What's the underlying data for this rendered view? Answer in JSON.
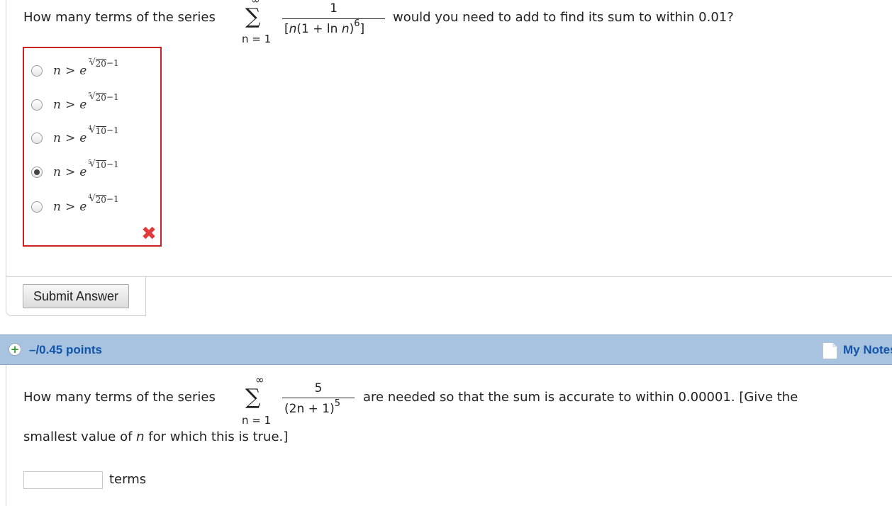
{
  "question1": {
    "prefix": "How many terms of the series",
    "sigma": "∑",
    "upper": "∞",
    "lower": "n = 1",
    "numerator": "1",
    "denominator_parts": [
      "[",
      "n",
      "(1 + ln ",
      "n",
      ")",
      "6",
      "]"
    ],
    "suffix": "would you need to add to find its sum to within 0.01?",
    "options": [
      {
        "index": "7",
        "radicand": "20",
        "tail": "−1",
        "selected": false
      },
      {
        "index": "5",
        "radicand": "20",
        "tail": "−1",
        "selected": false
      },
      {
        "index": "4",
        "radicand": "10",
        "tail": "−1",
        "selected": false
      },
      {
        "index": "5",
        "radicand": "10",
        "tail": "−1",
        "selected": true
      },
      {
        "index": "4",
        "radicand": "20",
        "tail": "−1",
        "selected": false
      }
    ],
    "option_lhs": "n",
    "option_rel": ">",
    "option_base": "e",
    "result_icon": "x-mark-icon",
    "submit_label": "Submit Answer"
  },
  "points_header": {
    "icon": "plus-circle-icon",
    "points": "–/0.45 points",
    "notes_icon": "notes-page-icon",
    "notes_label": "My Notes"
  },
  "question2": {
    "prefix": "How many terms of the series",
    "sigma": "∑",
    "upper": "∞",
    "lower": "n = 1",
    "numerator": "5",
    "denominator_base": "(2n + 1)",
    "denominator_exp": "5",
    "suffix": "are needed so that the sum is accurate to within 0.00001. [Give the",
    "line2_before": "smallest value of ",
    "line2_var": "n",
    "line2_after": " for which this is true.]",
    "input_value": "",
    "unit_label": "terms"
  },
  "colors": {
    "error_border": "#cc2222",
    "error_mark": "#e23b3b",
    "header_bar": "#a8c3df",
    "link": "#1155aa",
    "plus_green": "#2e9b2e"
  }
}
